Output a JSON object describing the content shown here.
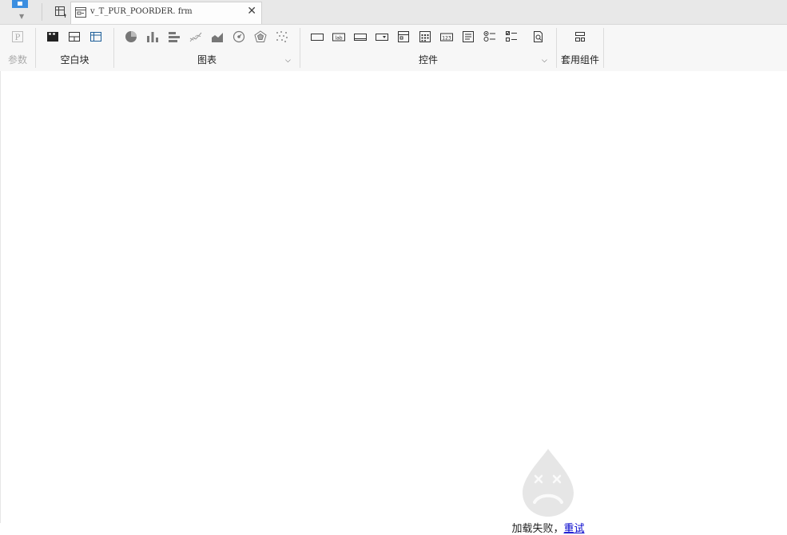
{
  "tabs": {
    "active_file": "v_T_PUR_POORDER. frm",
    "close_glyph": "✕"
  },
  "ribbon": {
    "param_label": "参数",
    "blank_label": "空白块",
    "chart_label": "图表",
    "control_label": "控件",
    "suite_label": "套用组件",
    "param_glyph": "P",
    "text_glyph": "lab",
    "num_glyph": "123",
    "chevron": "⌵"
  },
  "status": {
    "message": "加载失败，",
    "retry": "重试"
  },
  "colors": {
    "accent": "#3b8ee0",
    "disabled": "#aaaaaa",
    "link": "#0000cc",
    "error_icon": "#e6e6e6"
  }
}
